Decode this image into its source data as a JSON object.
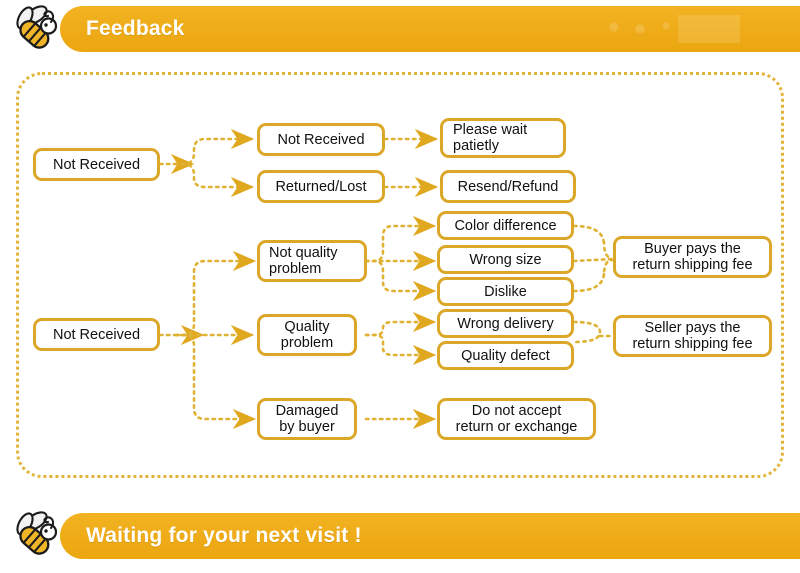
{
  "header": {
    "title": "Feedback",
    "icon": "bee-icon",
    "band_color": "#efab18",
    "text_color": "#ffffff"
  },
  "footer": {
    "title": "Waiting for your next visit !",
    "icon": "bee-icon",
    "band_color": "#efab18",
    "text_color": "#ffffff"
  },
  "flowchart": {
    "border_color": "#e3b43a",
    "node_border_color": "#dba728",
    "node_fill": "#ffffff",
    "connector_color": "#e0b233",
    "nodes": [
      {
        "id": "root1",
        "label": "Not Received"
      },
      {
        "id": "not-received",
        "label": "Not Received"
      },
      {
        "id": "returned-lost",
        "label": "Returned/Lost"
      },
      {
        "id": "please-wait",
        "label": "Please wait\npatietly"
      },
      {
        "id": "resend",
        "label": "Resend/Refund"
      },
      {
        "id": "root2",
        "label": "Not Received"
      },
      {
        "id": "not-quality",
        "label": "Not quality\nproblem"
      },
      {
        "id": "quality",
        "label": "Quality\nproblem"
      },
      {
        "id": "damaged",
        "label": "Damaged\nby buyer"
      },
      {
        "id": "color-diff",
        "label": "Color difference"
      },
      {
        "id": "wrong-size",
        "label": "Wrong size"
      },
      {
        "id": "dislike",
        "label": "Dislike"
      },
      {
        "id": "wrong-deliv",
        "label": "Wrong delivery"
      },
      {
        "id": "quality-def",
        "label": "Quality defect"
      },
      {
        "id": "buyer-pays",
        "label": "Buyer pays the\nreturn shipping fee"
      },
      {
        "id": "seller-pays",
        "label": "Seller pays the\nreturn shipping fee"
      },
      {
        "id": "no-return",
        "label": "Do not accept\nreturn or exchange"
      }
    ]
  }
}
